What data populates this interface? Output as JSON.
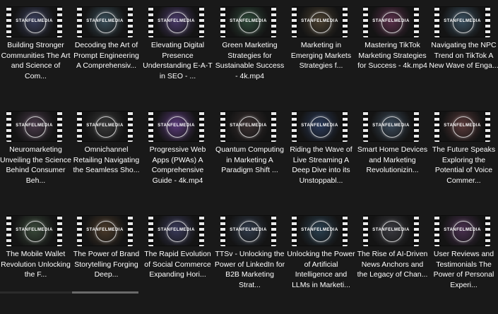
{
  "brand_logo": "STANFELMEDIA",
  "items": [
    {
      "caption": "Building Stronger Communities The Art and Science of Com...",
      "tint": "#3a3f5c"
    },
    {
      "caption": "Decoding the Art of Prompt Engineering A Comprehensiv...",
      "tint": "#3a4f5a"
    },
    {
      "caption": "Elevating Digital Presence Understanding E-A-T in SEO - ...",
      "tint": "#4a3a6a"
    },
    {
      "caption": "Green Marketing Strategies for Sustainable Success - 4k.mp4",
      "tint": "#2f4a3a"
    },
    {
      "caption": "Marketing in Emerging Markets Strategies f...",
      "tint": "#4a4030"
    },
    {
      "caption": "Mastering TikTok Marketing Strategies for Success - 4k.mp4",
      "tint": "#5a2f4a"
    },
    {
      "caption": "Navigating the NPC Trend on TikTok A New Wave of Enga...",
      "tint": "#3a5060"
    },
    {
      "caption": "Neuromarketing Unveiling the Science Behind Consumer Beh...",
      "tint": "#4a3a4a"
    },
    {
      "caption": "Omnichannel Retailing Navigating the Seamless Sho...",
      "tint": "#3a3a3a"
    },
    {
      "caption": "Progressive Web Apps (PWAs) A Comprehensive Guide - 4k.mp4",
      "tint": "#5a3a7a"
    },
    {
      "caption": "Quantum Computing in Marketing A Paradigm Shift ...",
      "tint": "#3a3030"
    },
    {
      "caption": "Riding the Wave of Live Streaming A Deep Dive into its Unstoppabl...",
      "tint": "#2a3a5a"
    },
    {
      "caption": "Smart Home Devices and Marketing Revolutionizin...",
      "tint": "#3a4a5a"
    },
    {
      "caption": "The Future Speaks Exploring the Potential of Voice Commer...",
      "tint": "#5a3a3a"
    },
    {
      "caption": "The Mobile Wallet Revolution Unlocking the F...",
      "tint": "#3a4a3a"
    },
    {
      "caption": "The Power of Brand Storytelling Forging Deep...",
      "tint": "#4a3a2a"
    },
    {
      "caption": "The Rapid Evolution of Social Commerce Expanding Hori...",
      "tint": "#3a3a5a"
    },
    {
      "caption": "TTSv - Unlocking the Power of LinkedIn for B2B Marketing Strat...",
      "tint": "#303a4a"
    },
    {
      "caption": "Unlocking the Power of Artificial Intelligence and LLMs in Marketi...",
      "tint": "#2a4050"
    },
    {
      "caption": "The Rise of AI-Driven News Anchors and the Legacy of Chan...",
      "tint": "#3a3a40"
    },
    {
      "caption": "User Reviews and Testimonials The Power of Personal Experi...",
      "tint": "#4a3050"
    }
  ]
}
